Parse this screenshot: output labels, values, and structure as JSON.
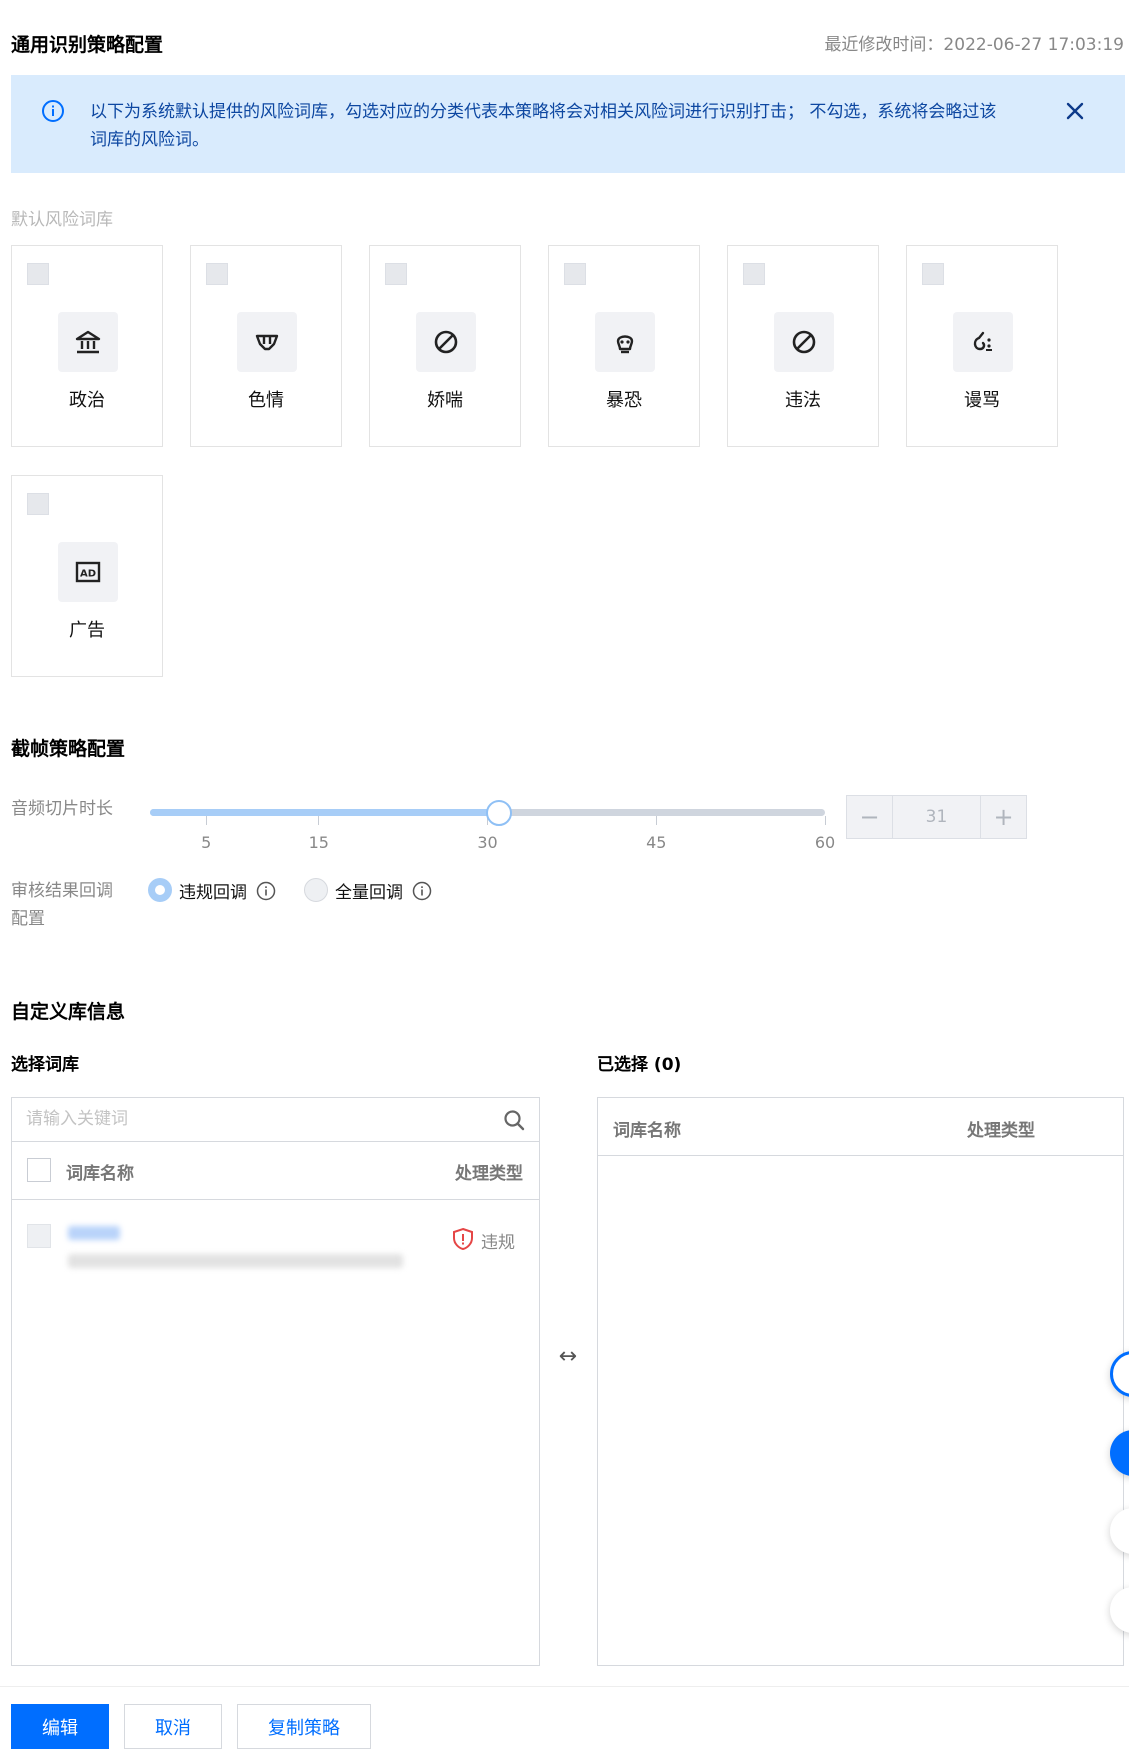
{
  "header": {
    "title": "通用识别策略配置",
    "last_modified": "最近修改时间：2022-06-27 17:03:19"
  },
  "banner": {
    "text": "以下为系统默认提供的风险词库，勾选对应的分类代表本策略将会对相关风险词进行识别打击；  不勾选，系统将会略过该词库的风险词。"
  },
  "default_library": {
    "label": "默认风险词库",
    "items": [
      {
        "label": "政治",
        "icon": "government-icon"
      },
      {
        "label": "色情",
        "icon": "underwear-icon"
      },
      {
        "label": "娇喘",
        "icon": "forbidden-icon"
      },
      {
        "label": "暴恐",
        "icon": "terror-icon"
      },
      {
        "label": "违法",
        "icon": "forbidden-icon"
      },
      {
        "label": "谩骂",
        "icon": "abuse-icon"
      },
      {
        "label": "广告",
        "icon": "ad-icon"
      }
    ]
  },
  "frame_strategy": {
    "title": "截帧策略配置",
    "slice_label": "音频切片时长",
    "slider": {
      "min": 0,
      "max": 60,
      "value": 31,
      "ticks": [
        "5",
        "15",
        "30",
        "45",
        "60"
      ]
    },
    "stepper": {
      "minus": "−",
      "value": "31",
      "plus": "+"
    },
    "callback_label": "审核结果回调配置",
    "callback_options": [
      {
        "label": "违规回调",
        "selected": true
      },
      {
        "label": "全量回调",
        "selected": false
      }
    ]
  },
  "custom_library": {
    "title": "自定义库信息",
    "select_title": "选择词库",
    "selected_title": "已选择 (0)",
    "search_placeholder": "请输入关键词",
    "columns": {
      "name": "词库名称",
      "type": "处理类型"
    },
    "rows": [
      {
        "type": "违规"
      }
    ],
    "transfer_icon": "↔"
  },
  "footer": {
    "edit": "编辑",
    "cancel": "取消",
    "copy": "复制策略"
  },
  "colors": {
    "primary": "#006eff",
    "banner_bg": "#d9ebfd",
    "violation": "#e54545"
  }
}
